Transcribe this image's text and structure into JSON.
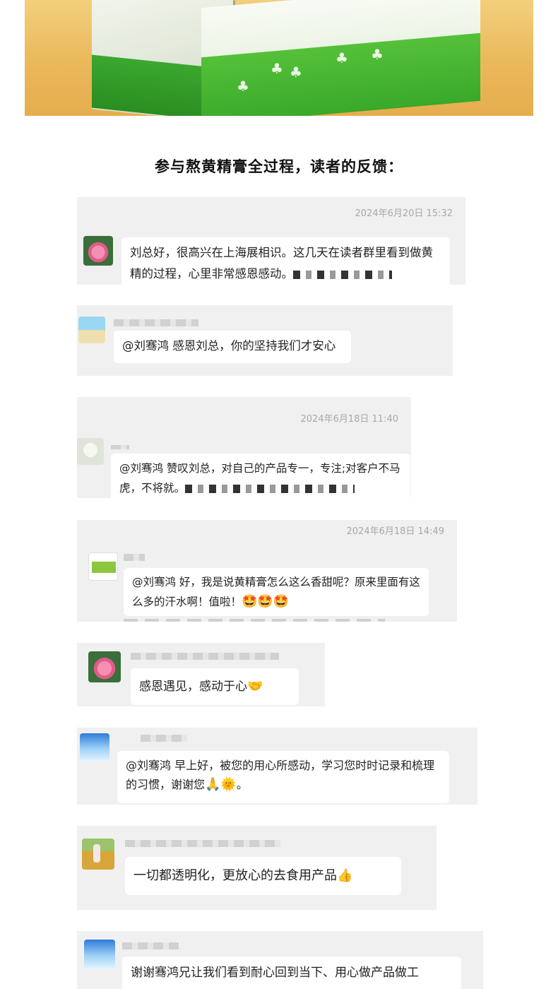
{
  "title": "参与熬黄精膏全过程，读者的反馈：",
  "messages": [
    {
      "timestamp": "2024年6月20日 15:32",
      "text": "刘总好，很高兴在上海展相识。这几天在读者群里看到做黄精的过程，心里非常感恩感动。",
      "avatar": "lotus-avatar"
    },
    {
      "timestamp": "",
      "text": "@刘骞鸿 感恩刘总，你的坚持我们才安心",
      "avatar": "beach-avatar"
    },
    {
      "timestamp": "2024年6月18日 11:40",
      "text": "@刘骞鸿 赞叹刘总，对自己的产品专一，专注;对客户不马虎，不将就。",
      "avatar": "face-avatar"
    },
    {
      "timestamp": "2024年6月18日 14:49",
      "text": "@刘骞鸿 好，我是说黄精膏怎么这么香甜呢？原来里面有这么多的汗水啊！值啦！",
      "emoji": "🤩🤩🤩",
      "avatar": "flag-avatar"
    },
    {
      "timestamp": "",
      "text": "感恩遇见，感动于心",
      "emoji": "🤝",
      "avatar": "lotus-avatar"
    },
    {
      "timestamp": "",
      "text": "@刘骞鸿 早上好，被您的用心所感动，学习您时时记录和梳理的习惯，谢谢您",
      "emoji": "🙏🌞",
      "suffix": "。",
      "avatar": "sky-avatar"
    },
    {
      "timestamp": "",
      "text": "一切都透明化，更放心的去食用产品",
      "emoji": "👍",
      "avatar": "field-avatar"
    },
    {
      "timestamp": "",
      "text": "谢谢骞鸿兄让我们看到耐心回到当下、用心做产品做工",
      "avatar": "sky-avatar"
    }
  ]
}
